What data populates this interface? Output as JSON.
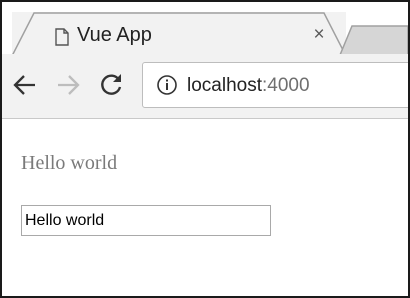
{
  "browser": {
    "tab": {
      "title": "Vue App",
      "close_glyph": "×",
      "icon": "document-icon"
    },
    "toolbar": {
      "back_icon": "arrow-left-icon",
      "forward_icon": "arrow-right-icon",
      "reload_icon": "reload-icon",
      "site_info_icon": "info-icon",
      "url_host": "localhost",
      "url_port": ":4000"
    }
  },
  "page": {
    "message": "Hello world",
    "input_value": "Hello world"
  },
  "colors": {
    "tab_background": "#f2f2f2",
    "message_text": "#7a7a7a",
    "url_port_text": "#6f6f6f"
  }
}
